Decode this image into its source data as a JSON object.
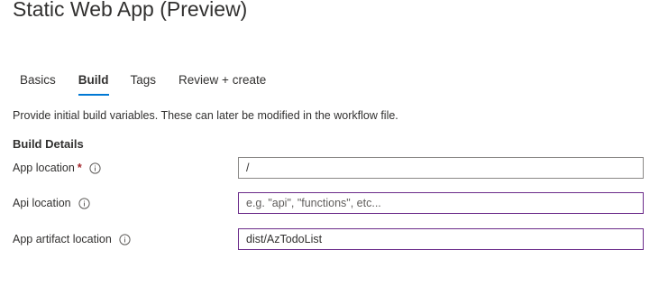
{
  "page": {
    "title": "Static Web App (Preview)"
  },
  "tabs": [
    {
      "label": "Basics",
      "active": false
    },
    {
      "label": "Build",
      "active": true
    },
    {
      "label": "Tags",
      "active": false
    },
    {
      "label": "Review + create",
      "active": false
    }
  ],
  "description": "Provide initial build variables. These can later be modified in the workflow file.",
  "section_title": "Build Details",
  "fields": {
    "app_location": {
      "label": "App location",
      "required_mark": "*",
      "value": "/",
      "placeholder": ""
    },
    "api_location": {
      "label": "Api location",
      "value": "",
      "placeholder": "e.g. \"api\", \"functions\", etc..."
    },
    "app_artifact_location": {
      "label": "App artifact location",
      "value": "dist/AzTodoList",
      "placeholder": ""
    }
  },
  "colors": {
    "active_tab_underline": "#0078d4",
    "required_mark": "#a4262c",
    "focused_input_border": "#6b2b8a",
    "default_input_border": "#8a8886"
  },
  "icons": {
    "field_info": "info-icon"
  }
}
